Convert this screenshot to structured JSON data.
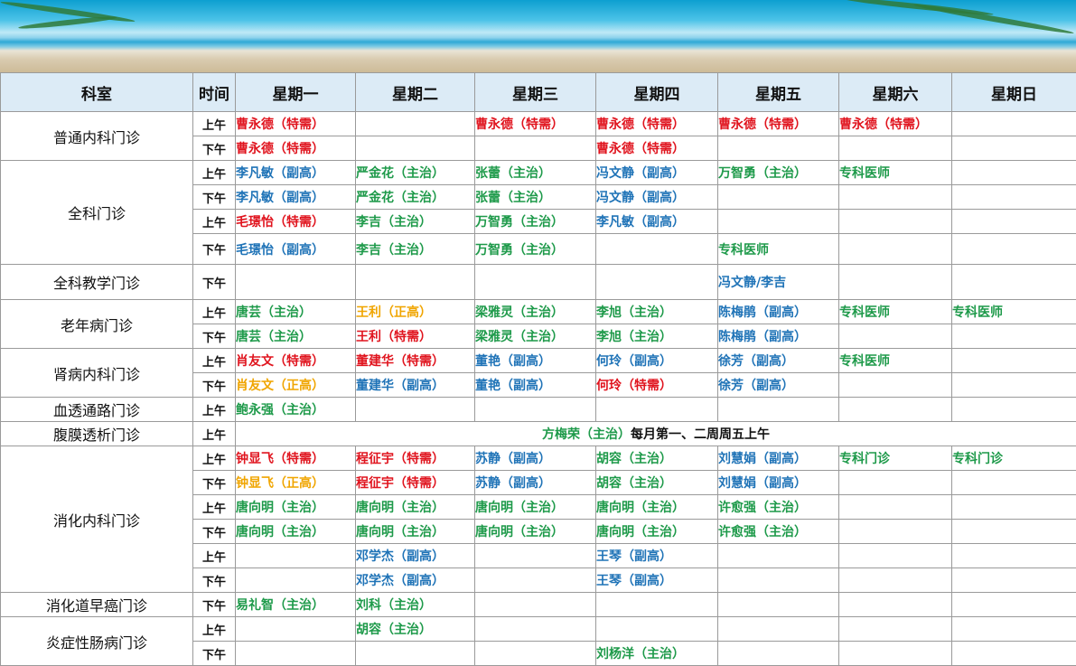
{
  "header": {
    "dept": "科室",
    "time": "时间",
    "days": [
      "星期一",
      "星期二",
      "星期三",
      "星期四",
      "星期五",
      "星期六",
      "星期日"
    ]
  },
  "rows": [
    {
      "dept": "普通内科门诊",
      "rowspan": 2,
      "time": "上午",
      "cells": [
        [
          "曹永德（特需）",
          "red"
        ],
        null,
        [
          "曹永德（特需）",
          "red"
        ],
        [
          "曹永德（特需）",
          "red"
        ],
        [
          "曹永德（特需）",
          "red"
        ],
        [
          "曹永德（特需）",
          "red"
        ],
        null
      ]
    },
    {
      "time": "下午",
      "cells": [
        [
          "曹永德（特需）",
          "red"
        ],
        null,
        null,
        [
          "曹永德（特需）",
          "red"
        ],
        null,
        null,
        null
      ]
    },
    {
      "dept": "全科门诊",
      "rowspan": 4,
      "time": "上午",
      "cells": [
        [
          "李凡敏（副高）",
          "blue"
        ],
        [
          "严金花（主治）",
          "green"
        ],
        [
          "张蕾（主治）",
          "green"
        ],
        [
          "冯文静（副高）",
          "blue"
        ],
        [
          "万智勇（主治）",
          "green"
        ],
        [
          "专科医师",
          "green"
        ],
        null
      ]
    },
    {
      "time": "下午",
      "cells": [
        [
          "李凡敏（副高）",
          "blue"
        ],
        [
          "严金花（主治）",
          "green"
        ],
        [
          "张蕾（主治）",
          "green"
        ],
        [
          "冯文静（副高）",
          "blue"
        ],
        null,
        null,
        null
      ]
    },
    {
      "time": "上午",
      "cells": [
        [
          "毛璟怡（特需）",
          "red"
        ],
        [
          "李吉（主治）",
          "green"
        ],
        [
          "万智勇（主治）",
          "green"
        ],
        [
          "李凡敏（副高）",
          "blue"
        ],
        null,
        null,
        null
      ]
    },
    {
      "time": "下午",
      "tall": true,
      "cells": [
        [
          "毛璟怡（副高）",
          "blue"
        ],
        [
          "李吉（主治）",
          "green"
        ],
        [
          "万智勇（主治）",
          "green"
        ],
        null,
        [
          "专科医师",
          "green"
        ],
        null,
        null
      ]
    },
    {
      "dept": "全科教学门诊",
      "rowspan": 1,
      "time": "下午",
      "tall2": true,
      "cells": [
        null,
        null,
        null,
        null,
        [
          "冯文静/李吉",
          "blue"
        ],
        null,
        null
      ]
    },
    {
      "dept": "老年病门诊",
      "rowspan": 2,
      "time": "上午",
      "cells": [
        [
          "唐芸（主治）",
          "green"
        ],
        [
          "王利（正高）",
          "orange"
        ],
        [
          "梁雅灵（主治）",
          "green"
        ],
        [
          "李旭（主治）",
          "green"
        ],
        [
          "陈梅鹃（副高）",
          "blue"
        ],
        [
          "专科医师",
          "green"
        ],
        [
          "专科医师",
          "green"
        ]
      ]
    },
    {
      "time": "下午",
      "cells": [
        [
          "唐芸（主治）",
          "green"
        ],
        [
          "王利（特需）",
          "red"
        ],
        [
          "梁雅灵（主治）",
          "green"
        ],
        [
          "李旭（主治）",
          "green"
        ],
        [
          "陈梅鹃（副高）",
          "blue"
        ],
        null,
        null
      ]
    },
    {
      "dept": "肾病内科门诊",
      "rowspan": 2,
      "time": "上午",
      "cells": [
        [
          "肖友文（特需）",
          "red"
        ],
        [
          "董建华（特需）",
          "red"
        ],
        [
          "董艳（副高）",
          "blue"
        ],
        [
          "何玲（副高）",
          "blue"
        ],
        [
          "徐芳（副高）",
          "blue"
        ],
        [
          "专科医师",
          "green"
        ],
        null
      ]
    },
    {
      "time": "下午",
      "cells": [
        [
          "肖友文（正高）",
          "orange"
        ],
        [
          "董建华（副高）",
          "blue"
        ],
        [
          "董艳（副高）",
          "blue"
        ],
        [
          "何玲（特需）",
          "red"
        ],
        [
          "徐芳（副高）",
          "blue"
        ],
        null,
        null
      ]
    },
    {
      "dept": "血透通路门诊",
      "rowspan": 1,
      "time": "上午",
      "cells": [
        [
          "鲍永强（主治）",
          "green"
        ],
        null,
        null,
        null,
        null,
        null,
        null
      ]
    },
    {
      "dept": "腹膜透析门诊",
      "rowspan": 1,
      "time": "上午",
      "merged": true
    },
    {
      "dept": "消化内科门诊",
      "rowspan": 6,
      "time": "上午",
      "cells": [
        [
          "钟显飞（特需）",
          "red"
        ],
        [
          "程征宇（特需）",
          "red"
        ],
        [
          "苏静（副高）",
          "blue"
        ],
        [
          "胡容（主治）",
          "green"
        ],
        [
          "刘慧娟（副高）",
          "blue"
        ],
        [
          "专科门诊",
          "green"
        ],
        [
          "专科门诊",
          "green"
        ]
      ]
    },
    {
      "time": "下午",
      "cells": [
        [
          "钟显飞（正高）",
          "orange"
        ],
        [
          "程征宇（特需）",
          "red"
        ],
        [
          "苏静（副高）",
          "blue"
        ],
        [
          "胡容（主治）",
          "green"
        ],
        [
          "刘慧娟（副高）",
          "blue"
        ],
        null,
        null
      ]
    },
    {
      "time": "上午",
      "cells": [
        [
          "唐向明（主治）",
          "green"
        ],
        [
          "唐向明（主治）",
          "green"
        ],
        [
          "唐向明（主治）",
          "green"
        ],
        [
          "唐向明（主治）",
          "green"
        ],
        [
          "许愈强（主治）",
          "green"
        ],
        null,
        null
      ]
    },
    {
      "time": "下午",
      "cells": [
        [
          "唐向明（主治）",
          "green"
        ],
        [
          "唐向明（主治）",
          "green"
        ],
        [
          "唐向明（主治）",
          "green"
        ],
        [
          "唐向明（主治）",
          "green"
        ],
        [
          "许愈强（主治）",
          "green"
        ],
        null,
        null
      ]
    },
    {
      "time": "上午",
      "cells": [
        null,
        [
          "邓学杰（副高）",
          "blue"
        ],
        null,
        [
          "王琴（副高）",
          "blue"
        ],
        null,
        null,
        null
      ]
    },
    {
      "time": "下午",
      "cells": [
        null,
        [
          "邓学杰（副高）",
          "blue"
        ],
        null,
        [
          "王琴（副高）",
          "blue"
        ],
        null,
        null,
        null
      ]
    },
    {
      "dept": "消化道早癌门诊",
      "rowspan": 1,
      "time": "下午",
      "cells": [
        [
          "易礼智（主治）",
          "green"
        ],
        [
          "刘科（主治）",
          "green"
        ],
        null,
        null,
        null,
        null,
        null
      ]
    },
    {
      "dept": "炎症性肠病门诊",
      "rowspan": 2,
      "time": "上午",
      "cells": [
        null,
        [
          "胡容（主治）",
          "green"
        ],
        null,
        null,
        null,
        null,
        null
      ]
    },
    {
      "time": "下午",
      "cells": [
        null,
        null,
        null,
        [
          "刘杨洋（主治）",
          "green"
        ],
        null,
        null,
        null
      ]
    }
  ],
  "merged_note": {
    "name": "方梅荣（主治）",
    "text": "每月第一、二周周五上午"
  }
}
